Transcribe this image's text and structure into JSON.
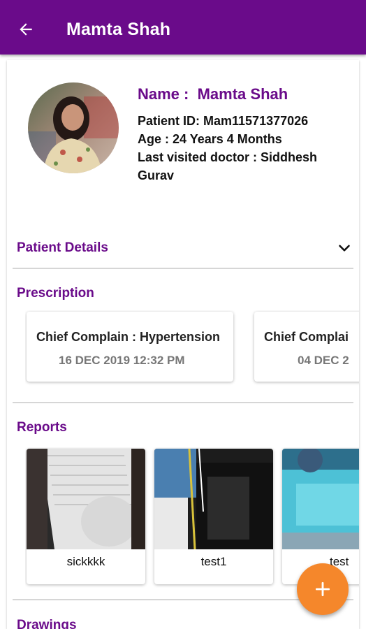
{
  "appbar": {
    "title": "Mamta Shah",
    "back_icon": "arrow-left-icon"
  },
  "profile": {
    "avatar_icon": "patient-photo",
    "name_label": "Name :",
    "name_value": "Mamta Shah",
    "patient_id": "Patient ID: Mam11571377026",
    "age": "Age : 24 Years 4 Months",
    "last_doctor": "Last visited doctor : Siddhesh Gurav"
  },
  "sections": {
    "patient_details": "Patient Details",
    "prescription": "Prescription",
    "reports": "Reports",
    "drawings": "Drawings"
  },
  "prescriptions": [
    {
      "complaint": "Chief Complain : Hypertension",
      "date": "16 DEC 2019 12:32 PM"
    },
    {
      "complaint": "Chief Complai",
      "date": "04 DEC 2"
    }
  ],
  "reports": [
    {
      "caption": "sickkkk"
    },
    {
      "caption": "test1"
    },
    {
      "caption": "test"
    }
  ],
  "fab": {
    "icon": "plus-icon",
    "color": "#f5872b"
  },
  "colors": {
    "primary": "#6a0b8a",
    "accent": "#f5872b"
  }
}
